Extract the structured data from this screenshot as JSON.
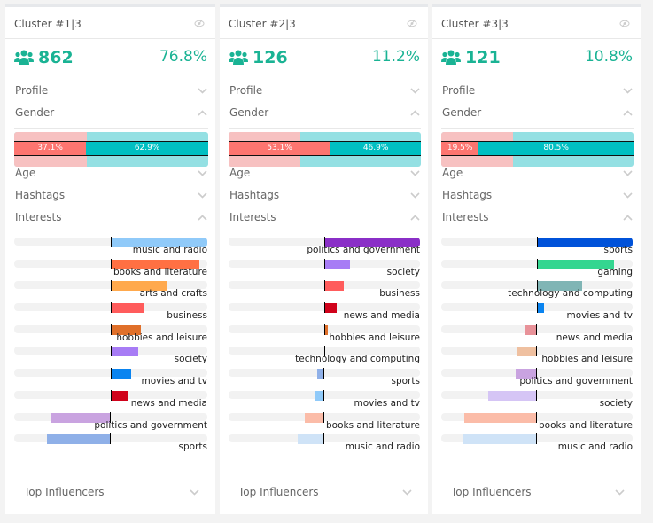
{
  "gender_baseline_female": 0.375,
  "clusters": [
    {
      "title": "Cluster #1|3",
      "count": "862",
      "percent": "76.8%",
      "sections": {
        "profile": "Profile",
        "gender": "Gender",
        "age": "Age",
        "hashtags": "Hashtags",
        "interests": "Interests",
        "top_influencers": "Top Influencers"
      },
      "gender": {
        "female_label": "37.1%",
        "male_label": "62.9%",
        "female": 0.371
      },
      "interests": [
        {
          "label": "music and radio",
          "value": 1.0,
          "color": "#90caf9"
        },
        {
          "label": "books and literature",
          "value": 0.92,
          "color": "#ff7043"
        },
        {
          "label": "arts and crafts",
          "value": 0.58,
          "color": "#ffa94d"
        },
        {
          "label": "business",
          "value": 0.35,
          "color": "#ff5c5c"
        },
        {
          "label": "hobbies and leisure",
          "value": 0.31,
          "color": "#e0702a"
        },
        {
          "label": "society",
          "value": 0.28,
          "color": "#a77cf5"
        },
        {
          "label": "movies and tv",
          "value": 0.21,
          "color": "#0a84f0"
        },
        {
          "label": "news and media",
          "value": 0.18,
          "color": "#d0021b"
        },
        {
          "label": "politics and government",
          "value": -0.62,
          "color": "#c9a3e0"
        },
        {
          "label": "sports",
          "value": -0.66,
          "color": "#8fb0e8"
        }
      ]
    },
    {
      "title": "Cluster #2|3",
      "count": "126",
      "percent": "11.2%",
      "sections": {
        "profile": "Profile",
        "gender": "Gender",
        "age": "Age",
        "hashtags": "Hashtags",
        "interests": "Interests",
        "top_influencers": "Top Influencers"
      },
      "gender": {
        "female_label": "53.1%",
        "male_label": "46.9%",
        "female": 0.531
      },
      "interests": [
        {
          "label": "politics and government",
          "value": 1.0,
          "color": "#8a2fc7"
        },
        {
          "label": "society",
          "value": 0.27,
          "color": "#a77cf5"
        },
        {
          "label": "business",
          "value": 0.2,
          "color": "#ff5c5c"
        },
        {
          "label": "news and media",
          "value": 0.13,
          "color": "#d0021b"
        },
        {
          "label": "hobbies and leisure",
          "value": 0.04,
          "color": "#e0702a"
        },
        {
          "label": "technology and computing",
          "value": 0.0,
          "color": "#7fb5b5"
        },
        {
          "label": "sports",
          "value": -0.07,
          "color": "#8fb0e8"
        },
        {
          "label": "movies and tv",
          "value": -0.09,
          "color": "#90caf9"
        },
        {
          "label": "books and literature",
          "value": -0.2,
          "color": "#fbbca8"
        },
        {
          "label": "music and radio",
          "value": -0.28,
          "color": "#cfe3f7"
        }
      ]
    },
    {
      "title": "Cluster #3|3",
      "count": "121",
      "percent": "10.8%",
      "sections": {
        "profile": "Profile",
        "gender": "Gender",
        "age": "Age",
        "hashtags": "Hashtags",
        "interests": "Interests",
        "top_influencers": "Top Influencers"
      },
      "gender": {
        "female_label": "19.5%",
        "male_label": "80.5%",
        "female": 0.195
      },
      "interests": [
        {
          "label": "sports",
          "value": 1.0,
          "color": "#0052d9"
        },
        {
          "label": "gaming",
          "value": 0.81,
          "color": "#34d690"
        },
        {
          "label": "technology and computing",
          "value": 0.47,
          "color": "#80b5b5"
        },
        {
          "label": "movies and tv",
          "value": 0.07,
          "color": "#0a84f0"
        },
        {
          "label": "news and media",
          "value": -0.13,
          "color": "#e89299"
        },
        {
          "label": "hobbies and leisure",
          "value": -0.2,
          "color": "#efc0a0"
        },
        {
          "label": "politics and government",
          "value": -0.22,
          "color": "#c9a3e0"
        },
        {
          "label": "society",
          "value": -0.51,
          "color": "#d5c5f5"
        },
        {
          "label": "books and literature",
          "value": -0.76,
          "color": "#fbbca8"
        },
        {
          "label": "music and radio",
          "value": -0.78,
          "color": "#cfe3f7"
        }
      ]
    }
  ]
}
